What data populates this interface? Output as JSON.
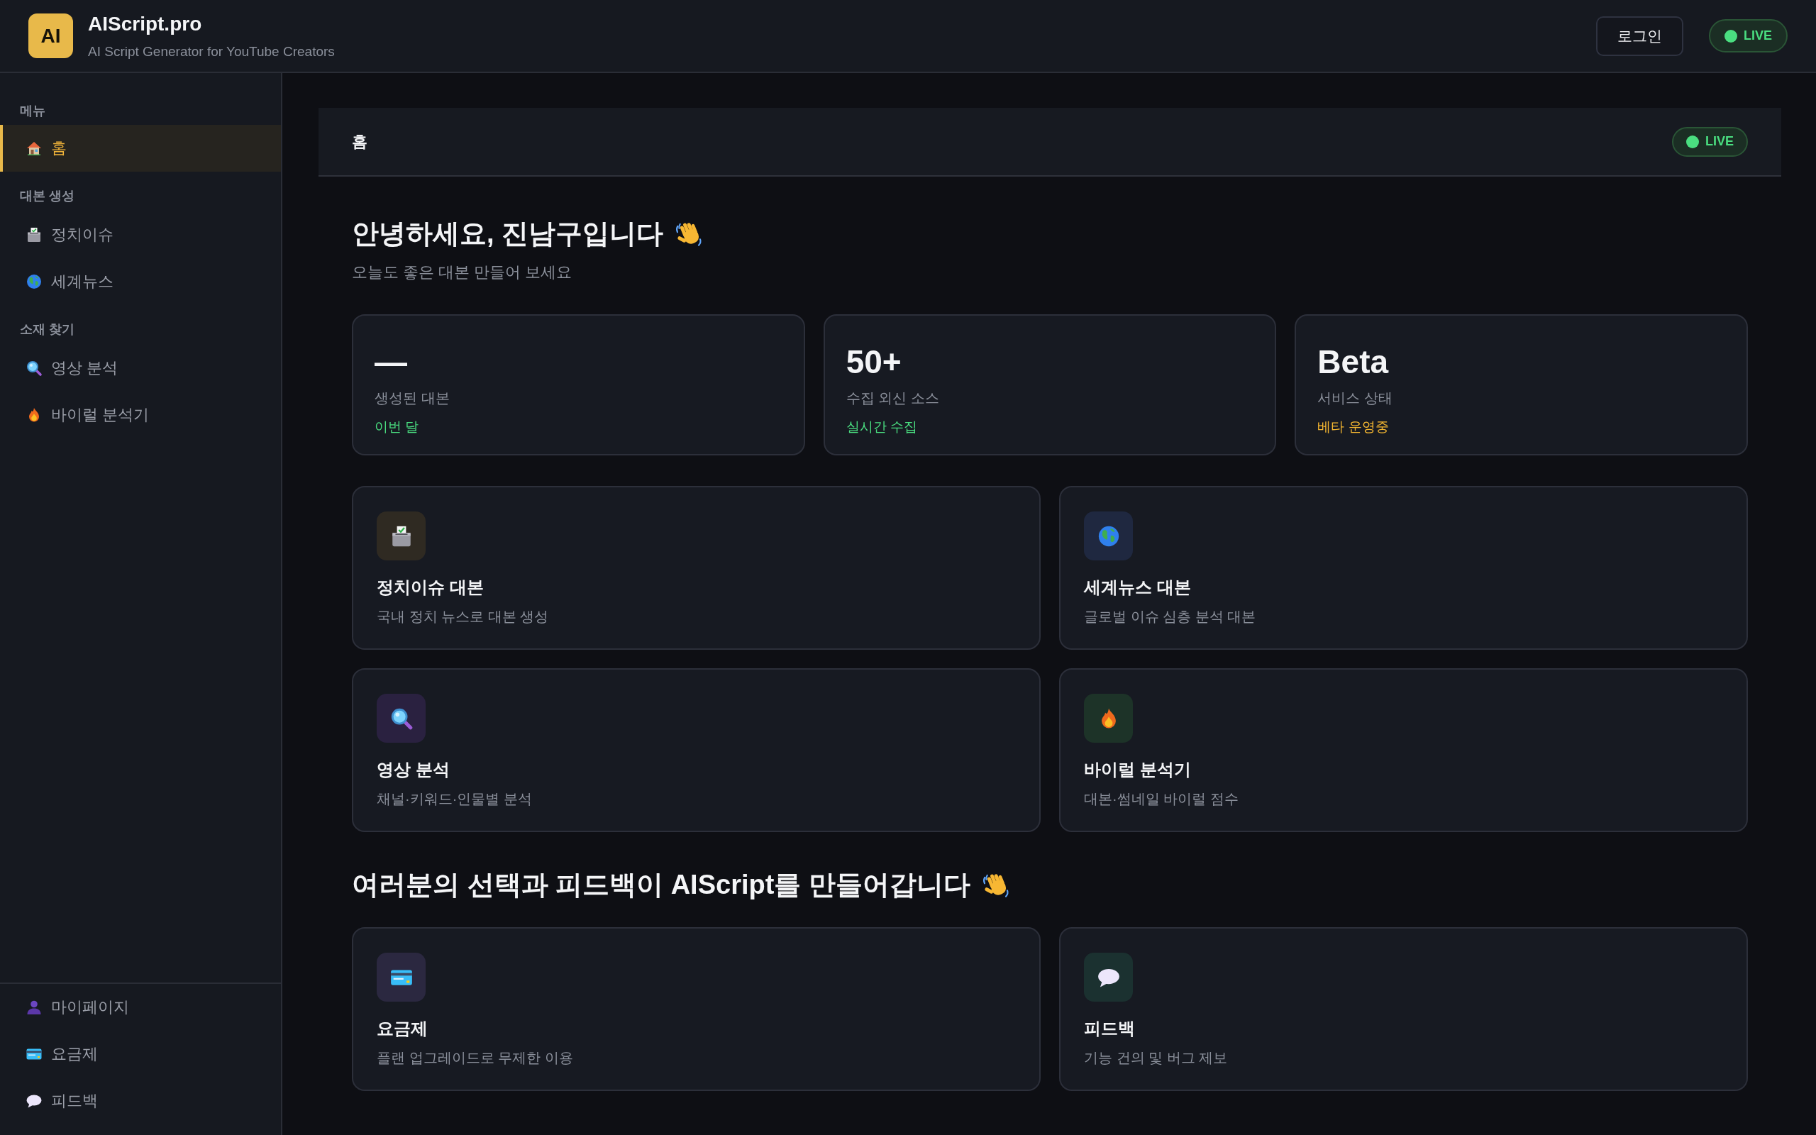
{
  "header": {
    "logo": "AI",
    "title": "AIScript.pro",
    "subtitle": "AI Script Generator for YouTube Creators",
    "login_button": "로그인",
    "status_badge": "LIVE"
  },
  "sidebar": {
    "sections": [
      {
        "label": "메뉴",
        "items": [
          {
            "kind": "home",
            "label": "홈",
            "selected": true
          }
        ]
      },
      {
        "label": "대본 생성",
        "items": [
          {
            "kind": "politics",
            "label": "정치이슈",
            "selected": false
          },
          {
            "kind": "world",
            "label": "세계뉴스",
            "selected": false
          }
        ]
      },
      {
        "label": "소재 찾기",
        "items": [
          {
            "kind": "video",
            "label": "영상 분석",
            "selected": false
          },
          {
            "kind": "viral",
            "label": "바이럴 분석기",
            "selected": false
          }
        ]
      }
    ],
    "footer_items": [
      {
        "kind": "account",
        "label": "마이페이지",
        "selected": false
      },
      {
        "kind": "pricing",
        "label": "요금제",
        "selected": false
      },
      {
        "kind": "feedback",
        "label": "피드백",
        "selected": false
      }
    ]
  },
  "page": {
    "title": "홈",
    "status_badge": "LIVE",
    "greeting": "안녕하세요, 진남구입니다",
    "greeting_subtitle": "오늘도 좋은 대본 만들어 보세요",
    "stats": [
      {
        "value": "—",
        "label": "생성된 대본",
        "note": "이번 달",
        "color": "#4ade80"
      },
      {
        "value": "50+",
        "label": "수집 외신 소스",
        "note": "실시간 수집",
        "color": "#4ade80"
      },
      {
        "value": "Beta",
        "label": "서비스 상태",
        "note": "베타 운영중",
        "color": "#f5b731"
      }
    ],
    "features": [
      {
        "kind": "politics",
        "title": "정치이슈 대본",
        "description": "국내 정치 뉴스로 대본 생성"
      },
      {
        "kind": "world",
        "title": "세계뉴스 대본",
        "description": "글로벌 이슈 심층 분석 대본"
      },
      {
        "kind": "video",
        "title": "영상 분석",
        "description": "채널·키워드·인물별 분석"
      },
      {
        "kind": "viral",
        "title": "바이럴 분석기",
        "description": "대본·썸네일 바이럴 점수"
      }
    ],
    "feedback_heading": "여러분의 선택과 피드백이 AIScript를 만들어갑니다",
    "links": [
      {
        "kind": "pricing",
        "title": "요금제",
        "description": "플랜 업그레이드로 무제한 이용"
      },
      {
        "kind": "feedback",
        "title": "피드백",
        "description": "기능 건의 및 버그 제보"
      }
    ]
  }
}
